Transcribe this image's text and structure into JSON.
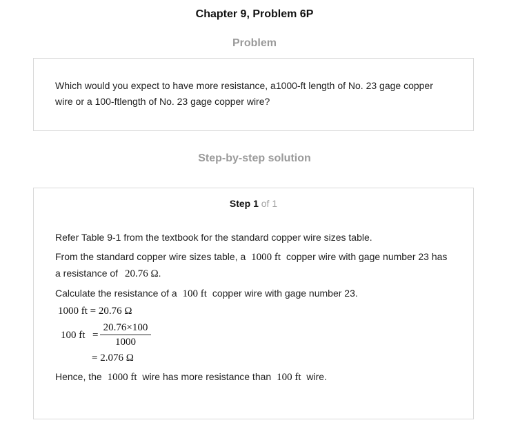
{
  "chapter_title": "Chapter 9, Problem 6P",
  "problem": {
    "heading": "Problem",
    "line1": "Which would you expect to have more resistance, a1000-ft length of No. 23 gage copper",
    "line2": "wire or a 100-ftlength of No. 23 gage copper wire?"
  },
  "solution": {
    "heading": "Step-by-step solution",
    "step_label": "Step 1",
    "step_of": "of 1",
    "p1": "Refer Table 9-1 from the textbook for the standard copper wire sizes table.",
    "p2_a": "From the standard copper wire sizes table, a",
    "p2_m1": "1000 ft",
    "p2_b": "copper wire with gage number 23 has",
    "p2_c": "a resistance of",
    "p2_m2": "20.76 Ω",
    "p2_end": ".",
    "p3_a": "Calculate the resistance of a",
    "p3_m": "100 ft",
    "p3_b": "copper wire with gage number 23.",
    "eq1": "1000 ft = 20.76 Ω",
    "eq2_lhs": "100 ft",
    "eq2_eq": "=",
    "eq2_num": "20.76×100",
    "eq2_den": "1000",
    "eq3": "= 2.076 Ω",
    "p4_a": "Hence, the",
    "p4_m1": "1000 ft",
    "p4_b": "wire has more resistance than",
    "p4_m2": "100 ft",
    "p4_c": "wire."
  }
}
